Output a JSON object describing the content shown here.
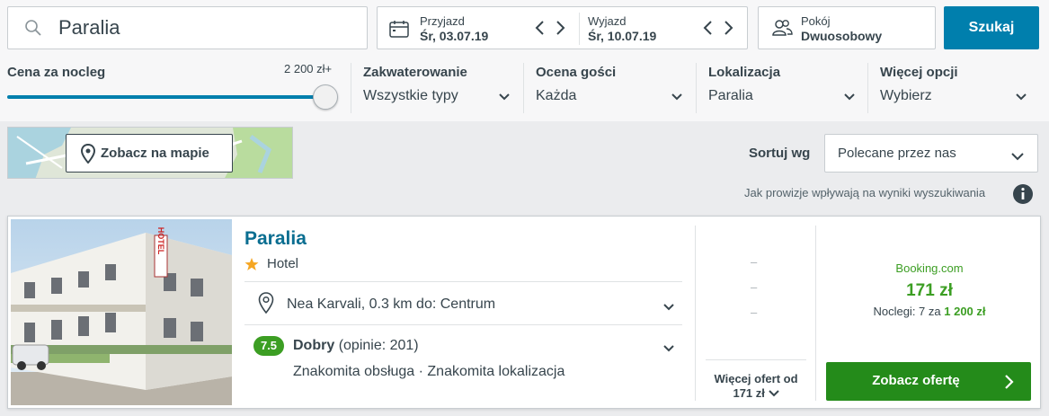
{
  "search": {
    "destination": "Paralia"
  },
  "dates": {
    "checkin_label": "Przyjazd",
    "checkin_value": "Śr, 03.07.19",
    "checkout_label": "Wyjazd",
    "checkout_value": "Śr, 10.07.19"
  },
  "room": {
    "label": "Pokój",
    "value": "Dwuosobowy"
  },
  "search_button": "Szukaj",
  "filters": {
    "price": {
      "label": "Cena za nocleg",
      "max_label": "2 200 zł+",
      "slider_fraction": 1.0
    },
    "accommodation": {
      "label": "Zakwaterowanie",
      "value": "Wszystkie typy"
    },
    "rating": {
      "label": "Ocena gości",
      "value": "Każda"
    },
    "location": {
      "label": "Lokalizacja",
      "value": "Paralia"
    },
    "more": {
      "label": "Więcej opcji",
      "value": "Wybierz"
    }
  },
  "map_button": "Zobacz na mapie",
  "sort": {
    "label": "Sortuj wg",
    "value": "Polecane przez nas"
  },
  "commission_note": "Jak prowizje wpływają na wyniki wyszukiwania",
  "result": {
    "name": "Paralia",
    "stars": 1,
    "type": "Hotel",
    "photo_sign": "HOTEL",
    "location": "Nea Karvali, 0.3 km do: Centrum",
    "rating_score": "7.5",
    "rating_word": "Dobry",
    "rating_count": "(opinie: 201)",
    "highlights": "Znakomita obsługa · Znakomita lokalizacja",
    "alt_prices": [
      "–",
      "–",
      "–"
    ],
    "more_offers_line1": "Więcej ofert od",
    "more_offers_line2": "171 zł",
    "provider": "Booking.com",
    "price": "171 zł",
    "nights_prefix": "Noclegi: 7 za",
    "nights_total": "1 200 zł",
    "cta": "Zobacz ofertę"
  },
  "colors": {
    "accent_blue": "#007fad",
    "link_blue": "#0a6e91",
    "green": "#3c9e23",
    "cta_green": "#248b1a",
    "star": "#f5a623"
  }
}
